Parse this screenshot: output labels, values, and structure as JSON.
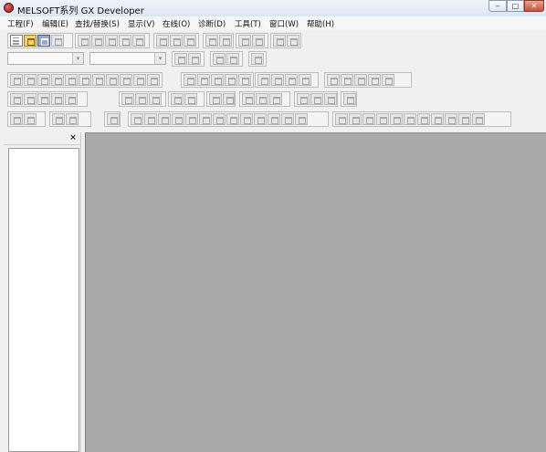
{
  "window": {
    "title": "MELSOFT系列 GX Developer",
    "min_icon": "minimize-icon",
    "max_icon": "maximize-icon",
    "close_icon": "close-icon",
    "min_glyph": "‒",
    "max_glyph": "□",
    "close_glyph": "✕"
  },
  "menu": {
    "items": [
      {
        "label": "工程(F)"
      },
      {
        "label": "编辑(E)"
      },
      {
        "label": "查找/替换(S)"
      },
      {
        "label": "显示(V)"
      },
      {
        "label": "在线(O)"
      },
      {
        "label": "诊断(D)"
      },
      {
        "label": "工具(T)"
      },
      {
        "label": "窗口(W)"
      },
      {
        "label": "帮助(H)"
      }
    ]
  },
  "toolbar": {
    "combo_1_value": "",
    "combo_2_value": "",
    "combo_arrow": "▾"
  },
  "side_panel": {
    "close_label": "×"
  },
  "colors": {
    "workspace": "#a9a9a9",
    "titlebar": "#dbe6f3"
  }
}
